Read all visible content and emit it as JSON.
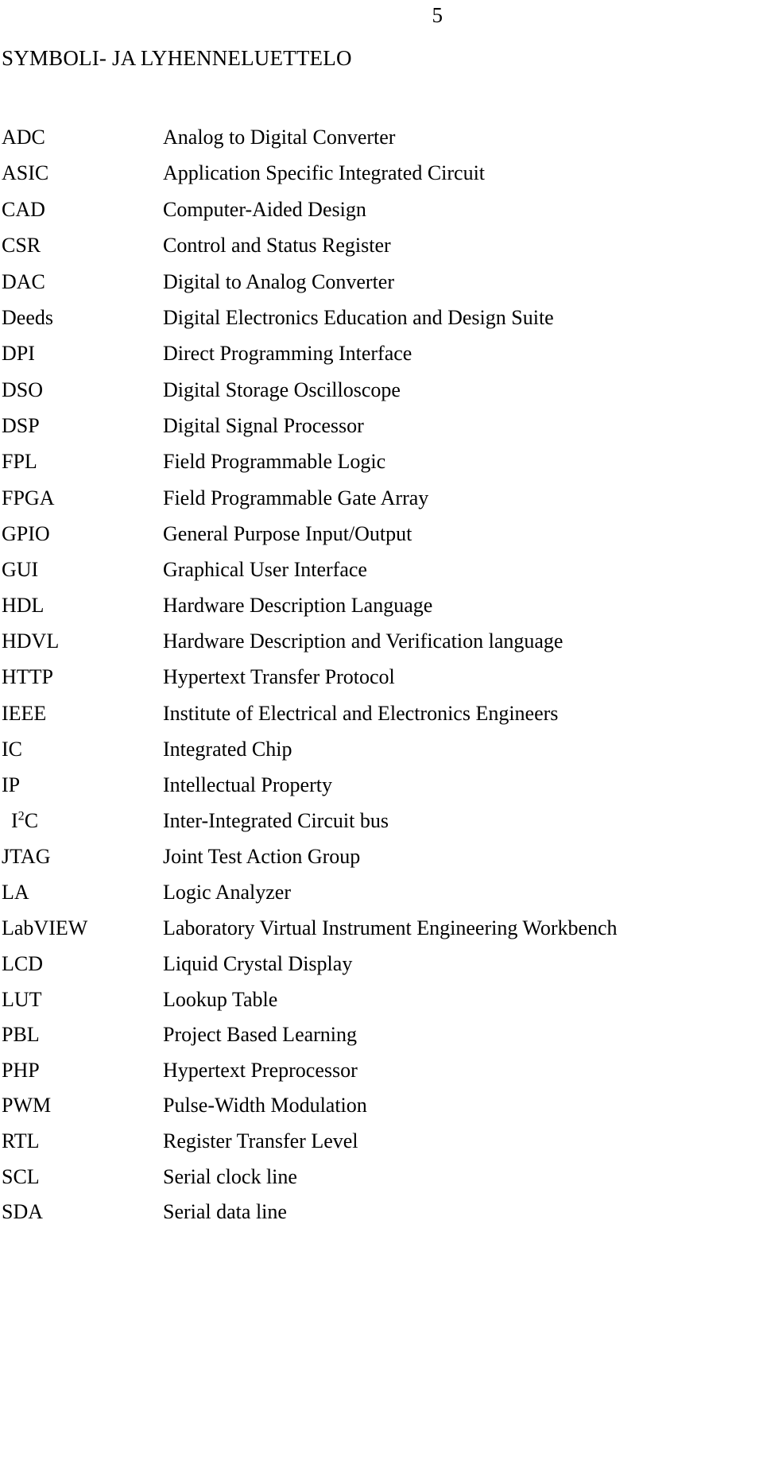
{
  "page": {
    "number": "5",
    "heading": "SYMBOLI- JA LYHENNELUETTELO"
  },
  "glossary": {
    "entries": [
      {
        "abbr": "ADC",
        "definition": "Analog to Digital Converter"
      },
      {
        "abbr": "ASIC",
        "definition": "Application Specific Integrated Circuit"
      },
      {
        "abbr": "CAD",
        "definition": "Computer-Aided Design"
      },
      {
        "abbr": "CSR",
        "definition": "Control and Status Register"
      },
      {
        "abbr": "DAC",
        "definition": "Digital to Analog Converter"
      },
      {
        "abbr": "Deeds",
        "definition": "Digital Electronics Education and Design Suite"
      },
      {
        "abbr": "DPI",
        "definition": "Direct Programming Interface"
      },
      {
        "abbr": "DSO",
        "definition": "Digital Storage Oscilloscope"
      },
      {
        "abbr": "DSP",
        "definition": "Digital Signal Processor"
      },
      {
        "abbr": "FPL",
        "definition": "Field Programmable Logic"
      },
      {
        "abbr": "FPGA",
        "definition": "Field Programmable Gate Array"
      },
      {
        "abbr": "GPIO",
        "definition": "General Purpose Input/Output"
      },
      {
        "abbr": "GUI",
        "definition": "Graphical User Interface"
      },
      {
        "abbr": "HDL",
        "definition": "Hardware Description Language"
      },
      {
        "abbr": "HDVL",
        "definition": "Hardware Description and Verification language"
      },
      {
        "abbr": "HTTP",
        "definition": "Hypertext Transfer Protocol"
      },
      {
        "abbr": "IEEE",
        "definition": "Institute of Electrical and Electronics Engineers"
      },
      {
        "abbr": "IC",
        "definition": "Integrated Chip"
      },
      {
        "abbr": "IP",
        "definition": "Intellectual Property"
      },
      {
        "abbr": "I2C",
        "abbr_base": "I",
        "abbr_sup": "2",
        "abbr_tail": "C",
        "definition": "Inter-Integrated Circuit bus"
      },
      {
        "abbr": "JTAG",
        "definition": "Joint Test Action Group"
      },
      {
        "abbr": "LA",
        "definition": "Logic Analyzer"
      },
      {
        "abbr": "LabVIEW",
        "definition": "Laboratory Virtual Instrument Engineering Workbench"
      },
      {
        "abbr": "LCD",
        "definition": "Liquid Crystal Display"
      },
      {
        "abbr": "LUT",
        "definition": "Lookup Table"
      },
      {
        "abbr": "PBL",
        "definition": "Project Based Learning"
      },
      {
        "abbr": "PHP",
        "definition": "Hypertext Preprocessor"
      },
      {
        "abbr": "PWM",
        "definition": "Pulse-Width Modulation"
      },
      {
        "abbr": "RTL",
        "definition": "Register Transfer Level"
      },
      {
        "abbr": "SCL",
        "definition": "Serial clock line"
      },
      {
        "abbr": "SDA",
        "definition": "Serial data line"
      }
    ]
  }
}
